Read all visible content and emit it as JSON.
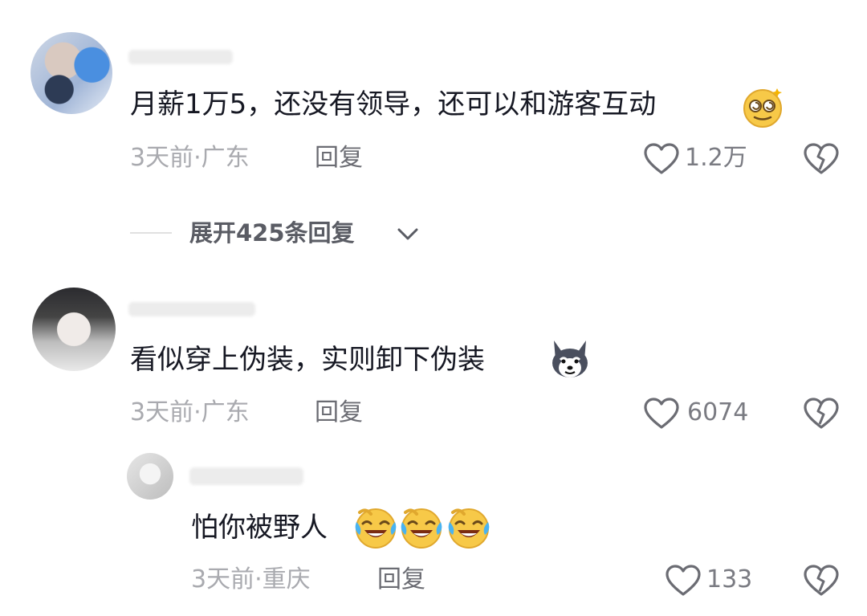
{
  "comments": [
    {
      "text": "月薪1万5，还没有领导，还可以和游客互动",
      "emoji": "dizzy-face-emoji",
      "meta": "3天前·广东",
      "reply_label": "回复",
      "likes": "1.2万"
    },
    {
      "text": "看似穿上伪装，实则卸下伪装",
      "emoji": "husky-dog-emoji",
      "meta": "3天前·广东",
      "reply_label": "回复",
      "likes": "6074",
      "expand_label": "展开425条回复"
    }
  ],
  "expand_label": "展开425条回复",
  "reply": {
    "text": "怕你被野人",
    "emoji": "crying-laughing-face-emoji",
    "meta": "3天前·重庆",
    "reply_label": "回复",
    "likes": "133"
  },
  "icons": {
    "like": "heart-outline-icon",
    "dislike": "broken-heart-icon",
    "expand": "chevron-down-icon"
  },
  "colors": {
    "text": "#161823",
    "meta": "#a9aaaf",
    "icon": "#6b6c73"
  }
}
